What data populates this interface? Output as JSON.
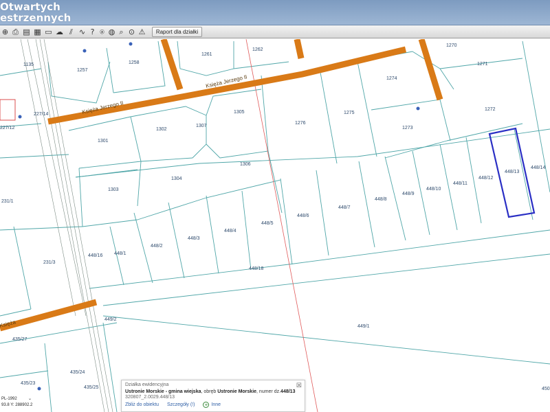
{
  "header": {
    "line1": "Otwartych",
    "line2": "estrzennych"
  },
  "toolbar": {
    "icons": [
      "zoom-in-icon",
      "print-icon",
      "layout-icon",
      "cloud-icon",
      "measure-icon",
      "distance-icon",
      "help-icon",
      "tree-icon",
      "globe-icon",
      "search-icon",
      "zoom-icon",
      "warning-icon"
    ],
    "report_button": "Raport dla działki"
  },
  "map": {
    "street_labels": [
      "Księża Jerzego II",
      "Księża"
    ],
    "parcels": [
      "1135",
      "1257",
      "1258",
      "1261",
      "1262",
      "1270",
      "1271",
      "1274",
      "1272",
      "1273",
      "1275",
      "1276",
      "1305",
      "1307",
      "1302",
      "1301",
      "1306",
      "1303",
      "1304",
      "227/14",
      "227/12",
      "231/1",
      "231/3",
      "448/16",
      "448/1",
      "448/2",
      "448/3",
      "448/4",
      "448/5",
      "448/6",
      "448/7",
      "448/8",
      "448/9",
      "448/10",
      "448/11",
      "448/12",
      "448/13",
      "448/14",
      "448/18",
      "449/2",
      "449/1",
      "435/27",
      "435/24",
      "435/23",
      "435/25",
      "450"
    ],
    "selected_parcel": "448/13",
    "selection_color": "#2a2fc4",
    "road_color": "#d97a17"
  },
  "popup": {
    "title": "Działka ewidencyjna",
    "line1_bold1": "Ustronie Morskie - gmina wiejska",
    "line1_mid": ", obręb ",
    "line1_bold2": "Ustronie Morskie",
    "line1_end": ", numer dz.",
    "line1_bold3": "448/13",
    "line2": "320807_2.0029.448/13",
    "link_zoom": "Zbliż do obiektu",
    "link_details": "Szczegóły (!)",
    "link_other": "Inne",
    "close": "☒"
  },
  "coords": {
    "crs": "PL-1992",
    "x": "93.8",
    "y": "Y: 288902.2"
  }
}
